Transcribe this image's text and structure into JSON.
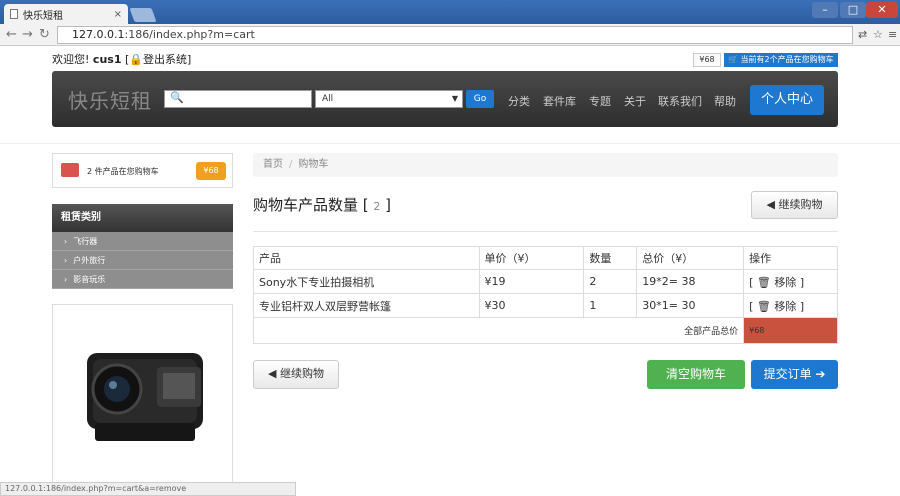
{
  "browser": {
    "tab_title": "快乐短租",
    "tab_close": "×",
    "url_host": "127.0.0.1",
    "url_rest": ":186/index.php?m=cart",
    "status_text": "127.0.0.1:186/index.php?m=cart&a=remove"
  },
  "header": {
    "welcome": "欢迎您!",
    "username": "cus1",
    "logout": "[🔒登出系统]",
    "mini_price": "¥68",
    "mini_cart": "🛒 当前有2个产品在您购物车",
    "brand": "快乐短租",
    "search_placeholder": "",
    "select_value": "All",
    "go_label": "Go",
    "nav": [
      "分类",
      "套件库",
      "专题",
      "关于",
      "联系我们",
      "帮助"
    ],
    "user_center": "个人中心"
  },
  "sidebar": {
    "cart_text": "2 件产品在您购物车",
    "cart_price": "¥68",
    "category_title": "租赁类别",
    "categories": [
      "飞行器",
      "户外旅行",
      "影音玩乐"
    ]
  },
  "main": {
    "breadcrumb_home": "首页",
    "breadcrumb_current": "购物车",
    "title": "购物车产品数量",
    "title_count": "2",
    "continue_label": "继续购物",
    "table_headers": [
      "产品",
      "单价（¥）",
      "数量",
      "总价（¥）",
      "操作"
    ],
    "rows": [
      {
        "name": "Sony水下专业拍摄相机",
        "price": "¥19",
        "qty": "2",
        "total": "19*2= 38",
        "action": "移除"
      },
      {
        "name": "专业铝杆双人双层野营帐篷",
        "price": "¥30",
        "qty": "1",
        "total": "30*1= 30",
        "action": "移除"
      }
    ],
    "total_label": "全部产品总价",
    "total_value": "¥68",
    "clear_label": "清空购物车",
    "submit_label": "提交订单 ➔"
  }
}
